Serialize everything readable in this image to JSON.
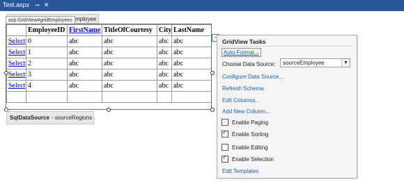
{
  "tab": {
    "title": "Test.aspx",
    "pin": "⊸",
    "close": "✕"
  },
  "source_employee": {
    "kind": "SqlDataSource",
    "name": "- sourceEmployee"
  },
  "source_regions": {
    "kind": "SqlDataSource",
    "name": "- sourceRegions"
  },
  "gridview_tag": "asp:GridView#gridEmployees",
  "grid": {
    "columns": [
      "",
      "EmployeeID",
      "FirstName",
      "TitleOfCourtesy",
      "City",
      "LastName"
    ],
    "select_label": "Select",
    "rows": [
      [
        "Select",
        "0",
        "abc",
        "abc",
        "abc",
        "abc"
      ],
      [
        "Select",
        "1",
        "abc",
        "abc",
        "abc",
        "abc"
      ],
      [
        "Select",
        "2",
        "abc",
        "abc",
        "abc",
        "abc"
      ],
      [
        "Select",
        "3",
        "abc",
        "abc",
        "abc",
        "abc"
      ],
      [
        "Select",
        "4",
        "abc",
        "abc",
        "abc",
        "abc"
      ]
    ]
  },
  "smart_tag": "‹",
  "tasks": {
    "title": "GridView Tasks",
    "auto_format": "Auto Format...",
    "choose_label": "Choose Data Source:",
    "choose_value": "sourceEmployee",
    "links": {
      "configure": "Configure Data Source...",
      "refresh": "Refresh Schema",
      "edit_columns": "Edit Columns...",
      "add_column": "Add New Column...",
      "edit_templates": "Edit Templates"
    },
    "options": {
      "paging": {
        "label": "Enable Paging",
        "checked": false
      },
      "sorting": {
        "label": "Enable Sorting",
        "checked": true
      },
      "editing": {
        "label": "Enable Editing",
        "checked": false
      },
      "selection": {
        "label": "Enable Selection",
        "checked": true
      }
    }
  },
  "colors": {
    "accent": "#2b579a",
    "link": "#1a5fb4",
    "grid_link": "#0000ee"
  }
}
